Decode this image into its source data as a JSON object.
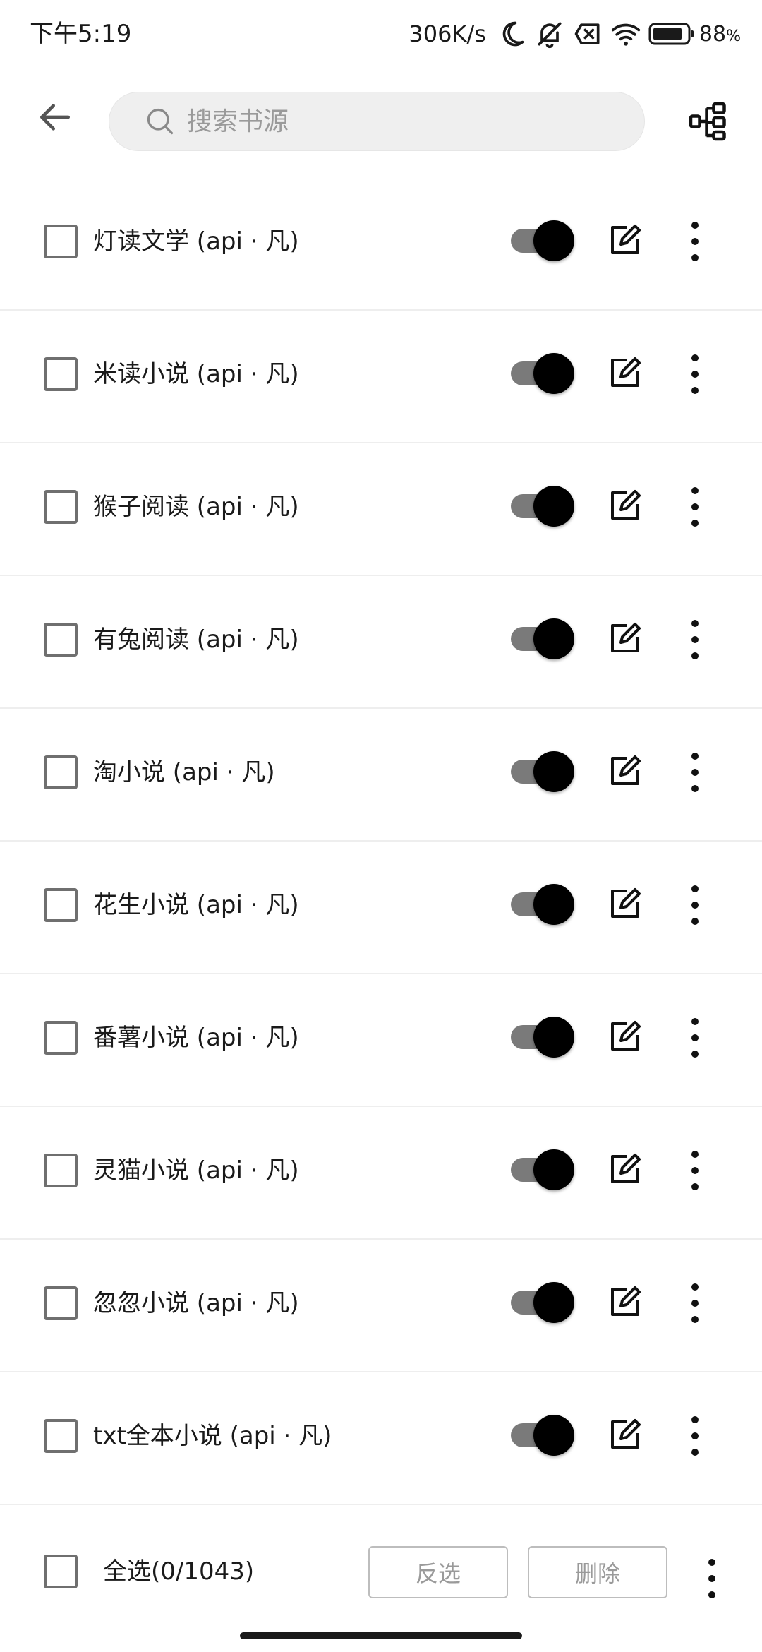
{
  "status_bar": {
    "time": "下午5:19",
    "net_speed": "306K/s",
    "battery_percent": "88",
    "battery_unit": "%",
    "battery_level": 0.88
  },
  "app_bar": {
    "back_icon": "arrow-left-icon",
    "search_placeholder": "搜索书源",
    "search_value": "",
    "group_icon": "group-tree-icon"
  },
  "sources": [
    {
      "name": "灯读文学 (api · 凡)",
      "enabled": true,
      "checked": false
    },
    {
      "name": "米读小说 (api · 凡)",
      "enabled": true,
      "checked": false
    },
    {
      "name": "猴子阅读 (api · 凡)",
      "enabled": true,
      "checked": false
    },
    {
      "name": "有兔阅读 (api · 凡)",
      "enabled": true,
      "checked": false
    },
    {
      "name": "淘小说 (api · 凡)",
      "enabled": true,
      "checked": false
    },
    {
      "name": "花生小说 (api · 凡)",
      "enabled": true,
      "checked": false
    },
    {
      "name": "番薯小说 (api · 凡)",
      "enabled": true,
      "checked": false
    },
    {
      "name": "灵猫小说 (api · 凡)",
      "enabled": true,
      "checked": false
    },
    {
      "name": "忽忽小说 (api · 凡)",
      "enabled": true,
      "checked": false
    },
    {
      "name": "txt全本小说 (api · 凡)",
      "enabled": true,
      "checked": false
    }
  ],
  "bottom_bar": {
    "select_all_label": "全选(0/1043)",
    "invert_label": "反选",
    "delete_label": "删除"
  },
  "colors": {
    "toggle_track": "#7a7a7a",
    "toggle_thumb": "#000000",
    "checkbox_border": "#6f6f6f",
    "search_bg": "#efefef",
    "disabled_button_text": "#9a9a9a"
  }
}
